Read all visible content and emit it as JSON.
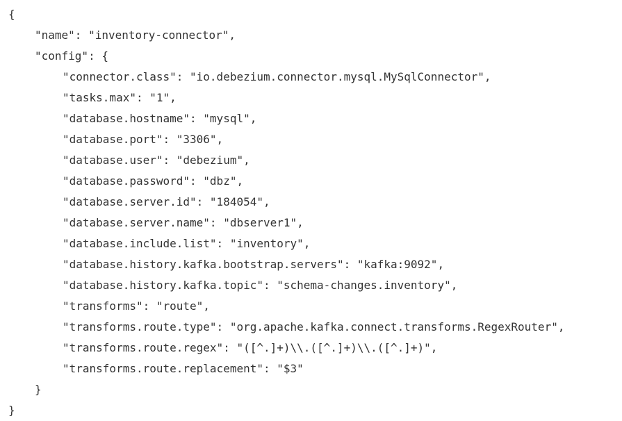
{
  "code": {
    "open_root": "{",
    "name_line": "\"name\": \"inventory-connector\",",
    "config_open": "\"config\": {",
    "config_lines": [
      "\"connector.class\": \"io.debezium.connector.mysql.MySqlConnector\",",
      "\"tasks.max\": \"1\",",
      "\"database.hostname\": \"mysql\",",
      "\"database.port\": \"3306\",",
      "\"database.user\": \"debezium\",",
      "\"database.password\": \"dbz\",",
      "\"database.server.id\": \"184054\",",
      "\"database.server.name\": \"dbserver1\",",
      "\"database.include.list\": \"inventory\",",
      "\"database.history.kafka.bootstrap.servers\": \"kafka:9092\",",
      "\"database.history.kafka.topic\": \"schema-changes.inventory\",",
      "\"transforms\": \"route\",",
      "\"transforms.route.type\": \"org.apache.kafka.connect.transforms.RegexRouter\",",
      "\"transforms.route.regex\": \"([^.]+)\\\\.([^.]+)\\\\.([^.]+)\",",
      "\"transforms.route.replacement\": \"$3\""
    ],
    "config_close": "}",
    "close_root": "}"
  },
  "colors": {
    "text": "#333333",
    "background": "#ffffff"
  }
}
